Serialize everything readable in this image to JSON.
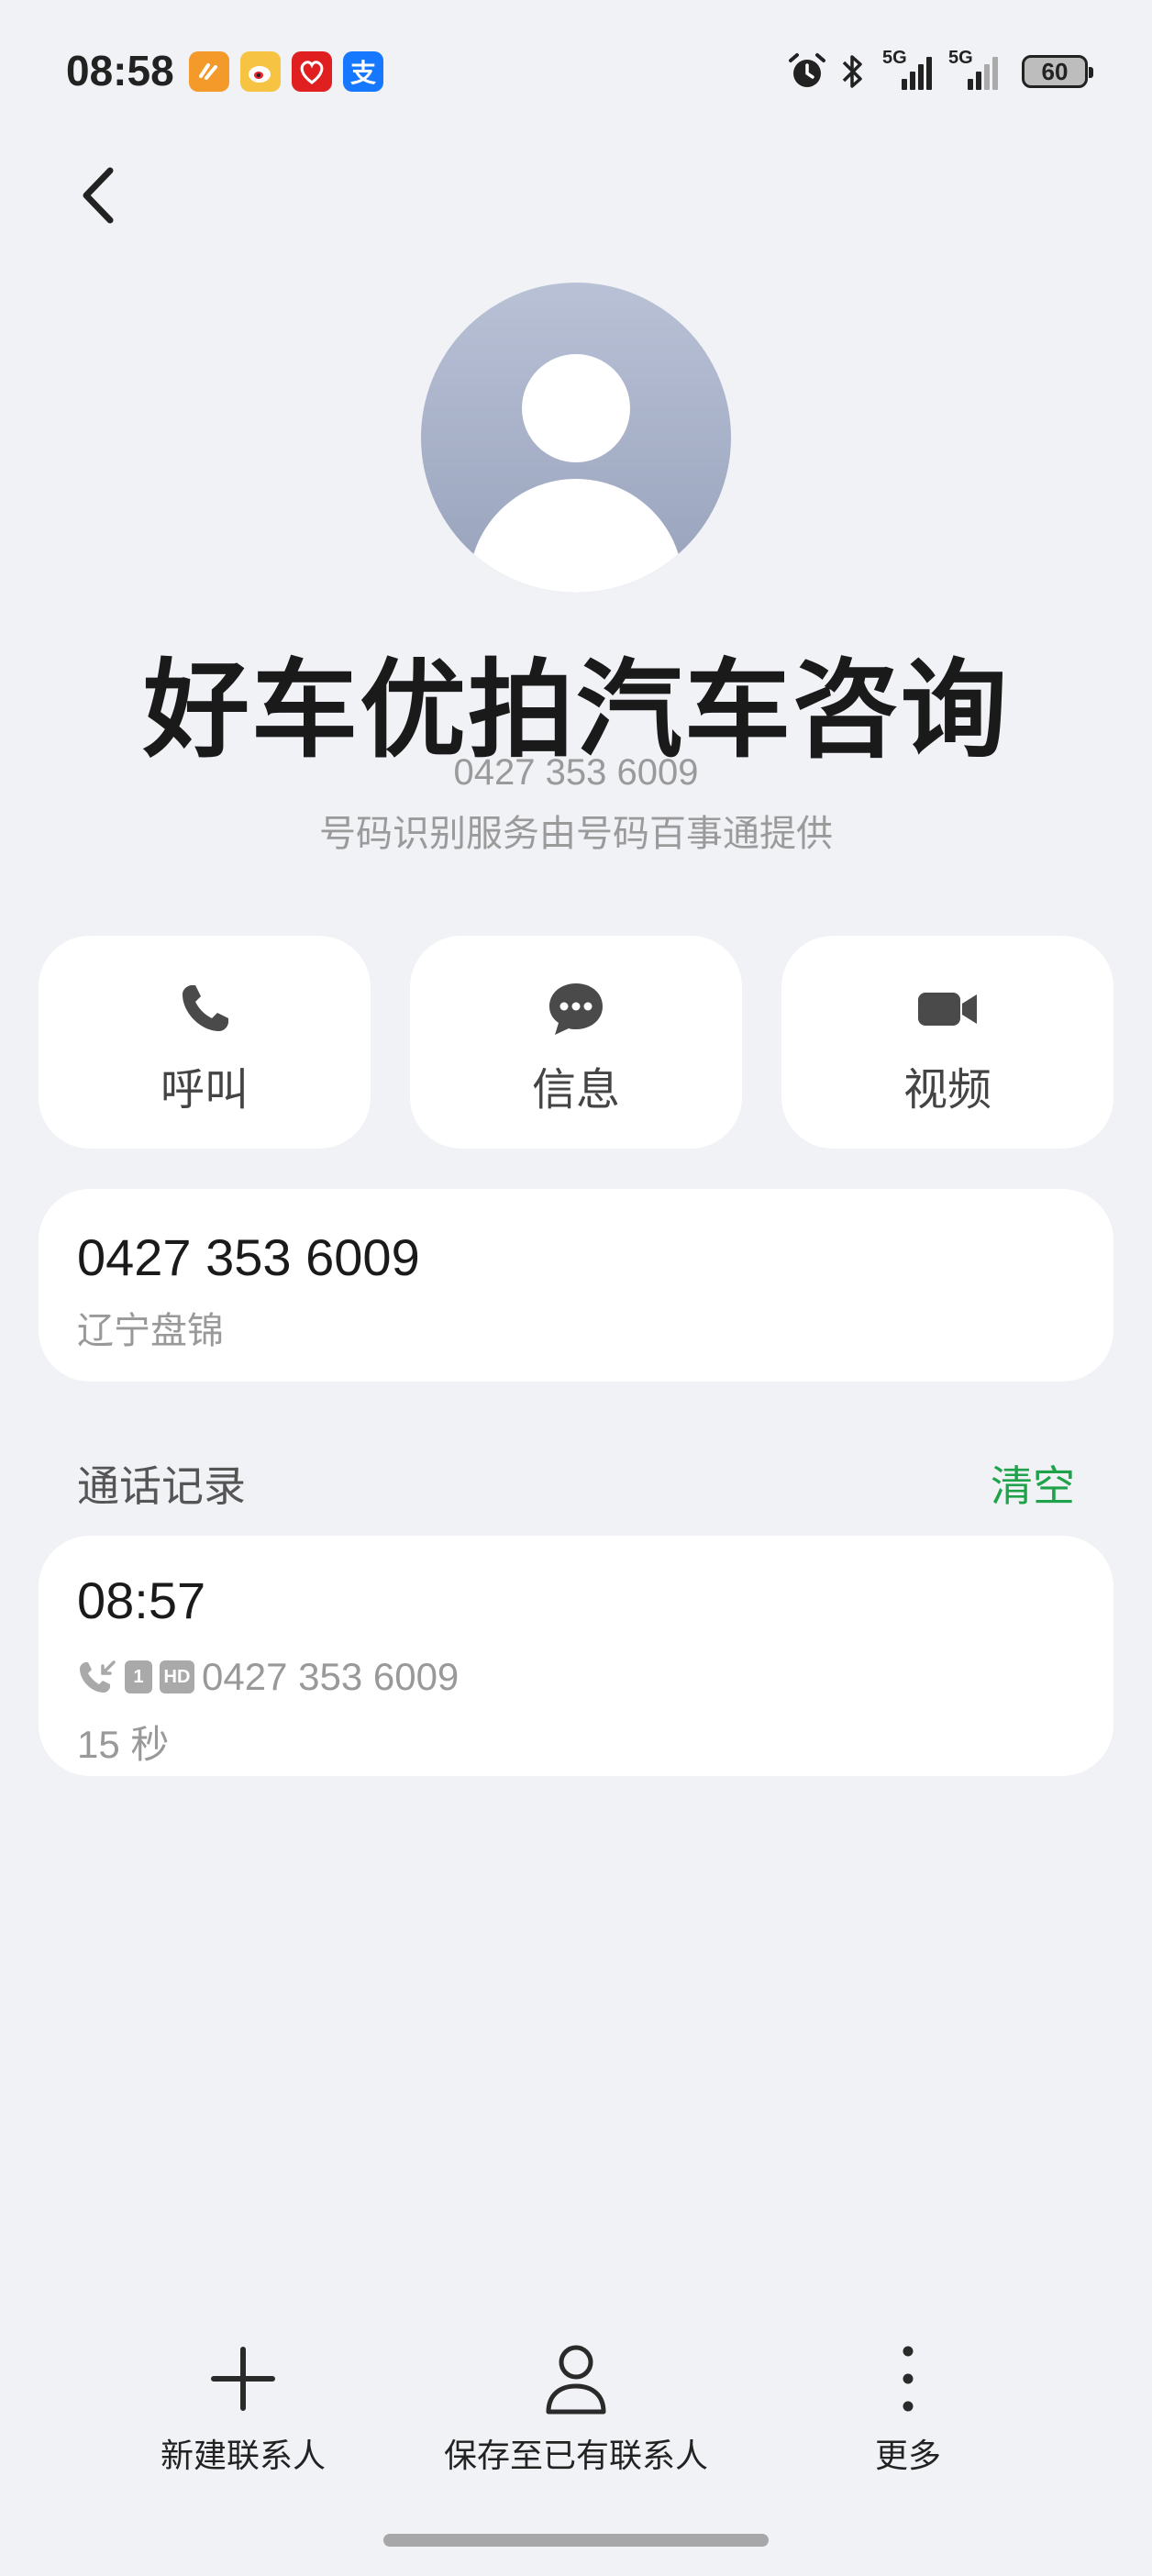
{
  "status_bar": {
    "time": "08:58",
    "apps": [
      "taobao-icon",
      "weibo-icon",
      "pinduoduo-icon",
      "alipay-icon"
    ],
    "signal1": "5G",
    "signal2": "5G",
    "battery": "60"
  },
  "contact": {
    "name": "好车优拍汽车咨询",
    "number": "0427 353 6009",
    "provider_note": "号码识别服务由号码百事通提供"
  },
  "actions": {
    "call": "呼叫",
    "message": "信息",
    "video": "视频"
  },
  "number_card": {
    "number": "0427 353 6009",
    "location": "辽宁盘锦"
  },
  "call_log": {
    "title": "通话记录",
    "clear": "清空",
    "entries": [
      {
        "time": "08:57",
        "sim": "1",
        "hd": "HD",
        "number": "0427 353 6009",
        "duration": "15 秒"
      }
    ]
  },
  "bottom": {
    "new_contact": "新建联系人",
    "save_existing": "保存至已有联系人",
    "more": "更多"
  },
  "colors": {
    "accent_green": "#1fa34a",
    "background": "#f1f2f6"
  }
}
